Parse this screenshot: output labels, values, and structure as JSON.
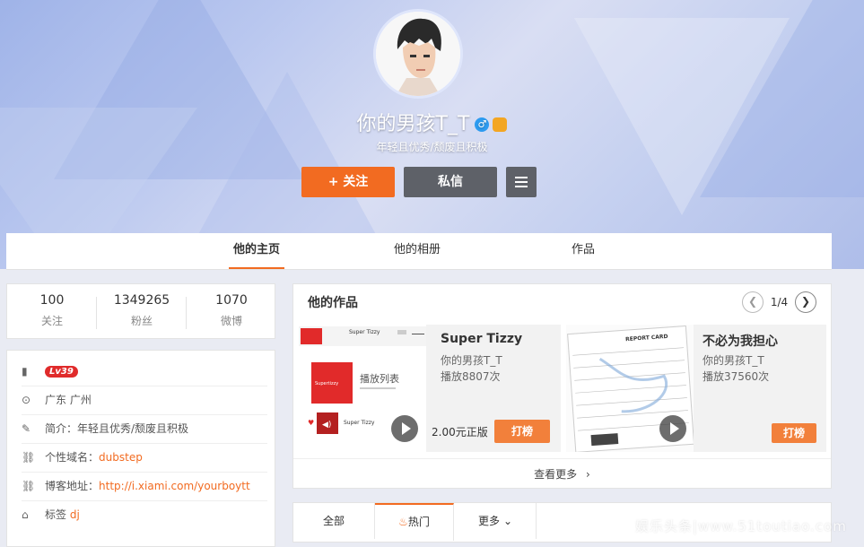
{
  "profile": {
    "name": "你的男孩T_T",
    "gender_icon": "male-icon",
    "motto": "年轻且优秀/颓废且积极",
    "follow_label": "+ 关注",
    "message_label": "私信"
  },
  "nav_tabs": [
    {
      "label": "他的主页",
      "active": true
    },
    {
      "label": "他的相册",
      "active": false
    },
    {
      "label": "作品",
      "active": false
    }
  ],
  "stats": [
    {
      "value": "100",
      "label": "关注"
    },
    {
      "value": "1349265",
      "label": "粉丝"
    },
    {
      "value": "1070",
      "label": "微博"
    }
  ],
  "info": {
    "level": "Lv39",
    "location": "广东 广州",
    "intro_label": "简介：",
    "intro": "年轻且优秀/颓废且积极",
    "domain_label": "个性域名：",
    "domain": "dubstep",
    "blog_label": "博客地址：",
    "blog": "http://i.xiami.com/yourboytt",
    "tags_label": "标签",
    "tags": "dj"
  },
  "works": {
    "title": "他的作品",
    "page": "1/4",
    "items": [
      {
        "title": "Super Tizzy",
        "artist": "你的男孩T_T",
        "plays": "播放8807次",
        "price": "2.00元正版",
        "rank_label": "打榜",
        "cover_texts": [
          "Super Tizzy",
          "播放列表",
          "Supertizzy",
          "Super Tizzy"
        ]
      },
      {
        "title": "不必为我担心",
        "artist": "你的男孩T_T",
        "plays": "播放37560次",
        "rank_label": "打榜",
        "cover_texts": [
          "REPORT CARD"
        ]
      }
    ],
    "more_label": "查看更多"
  },
  "sub_tabs": [
    {
      "label": "全部",
      "active": false
    },
    {
      "label": "热门",
      "active": true
    },
    {
      "label": "更多",
      "active": false
    }
  ],
  "watermark": "娱乐头条|www.51toutiao.com",
  "colors": {
    "accent": "#f26b21",
    "dark_button": "#5e6168",
    "level_badge": "#e02b2b"
  }
}
